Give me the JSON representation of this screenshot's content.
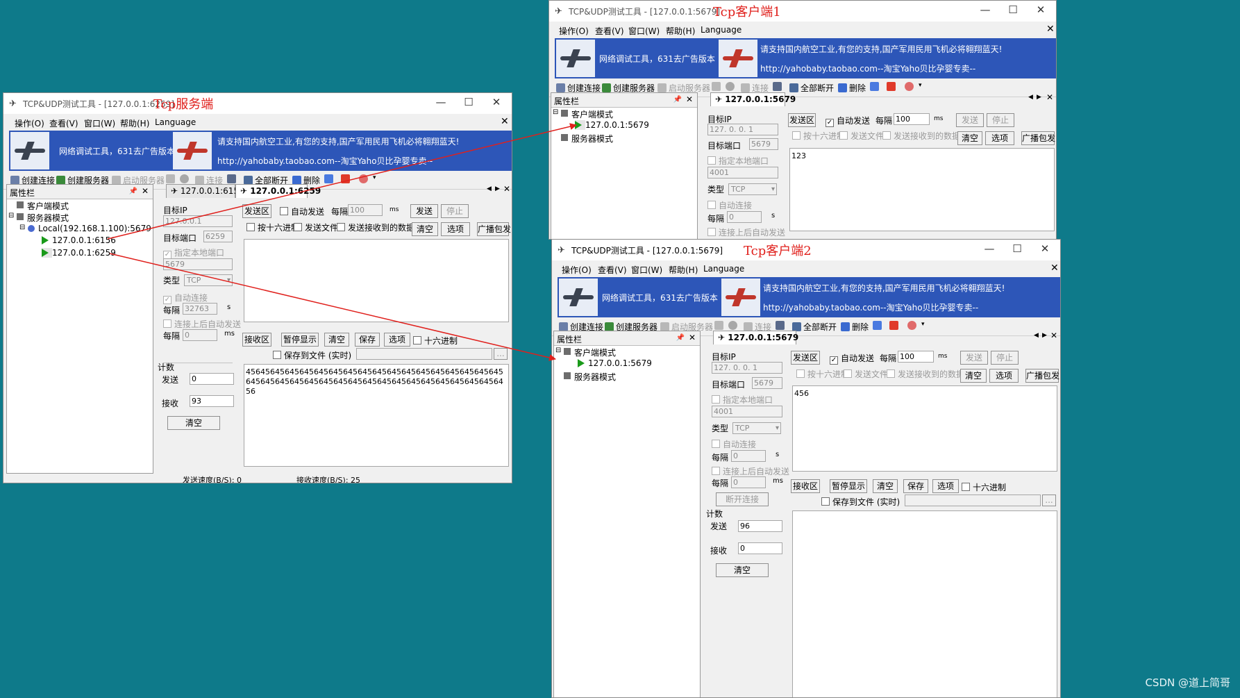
{
  "common": {
    "menu": [
      "操作(O)",
      "查看(V)",
      "窗口(W)",
      "帮助(H)",
      "Language"
    ],
    "banner_ad": "网络调试工具，631去广告版本",
    "banner_slogan": "请支持国内航空工业,有您的支持,国产军用民用飞机必将翱翔蓝天!",
    "banner_url": "http://yahobaby.taobao.com--淘宝Yaho贝比孕婴专卖--",
    "toolbar": {
      "create_conn": "创建连接",
      "create_server": "创建服务器",
      "start_server": "启动服务器",
      "connect": "连接",
      "disconnect_all": "全部断开",
      "delete": "删除"
    },
    "props_title": "属性栏",
    "tree_client": "客户端模式",
    "tree_server": "服务器模式",
    "target_ip_label": "目标IP",
    "target_port_label": "目标端口",
    "local_port_label": "指定本地端口",
    "type_label": "类型",
    "auto_connect_label": "自动连接",
    "every_label": "每隔",
    "auto_send_after_label": "连接上后自动发送",
    "send_area": "发送区",
    "auto_send": "自动发送",
    "ms": "ms",
    "s": "s",
    "send": "发送",
    "stop": "停止",
    "hex_send": "按十六进制",
    "send_file": "发送文件",
    "send_received": "发送接收到的数据",
    "clear": "清空",
    "options": "选项",
    "broadcast": "广播包发",
    "recv_area": "接收区",
    "pause_display": "暂停显示",
    "save": "保存",
    "hex": "十六进制",
    "save_to_file": "保存到文件 (实时)",
    "count": "计数",
    "sent": "发送",
    "received": "接收",
    "disconnect": "断开连接",
    "ellipsis": "..."
  },
  "server": {
    "title": "TCP&UDP测试工具 - [127.0.0.1:6259]",
    "caption": "Tcp服务端",
    "local": "Local(192.168.1.100):5679",
    "client1": "127.0.0.1:6156",
    "client2": "127.0.0.1:6259",
    "tab1": "127.0.0.1:6156",
    "tab2": "127.0.0.1:6259",
    "target_ip": "127.0.0.1",
    "target_port": "6259",
    "local_port": "5679",
    "type": "TCP",
    "every_s": "32763",
    "every_ms": "0",
    "send_interval": "100",
    "sent_count": "0",
    "recv_count": "93",
    "recv_text": "456456456456456456456456456456456456456456456456456456456456456456456456456456456456456456456456456456456456",
    "send_speed": "发送速度(B/S): 0",
    "recv_speed": "接收速度(B/S): 25"
  },
  "client1": {
    "title": "TCP&UDP测试工具 - [127.0.0.1:5679]",
    "caption": "Tcp客户端1",
    "tree_item": "127.0.0.1:5679",
    "tab": "127.0.0.1:5679",
    "target_ip": "127. 0. 0. 1",
    "target_port": "5679",
    "local_port": "4001",
    "type": "TCP",
    "every_s": "0",
    "send_interval": "100",
    "send_text": "123"
  },
  "client2": {
    "title": "TCP&UDP测试工具 - [127.0.0.1:5679]",
    "caption": "Tcp客户端2",
    "tree_item": "127.0.0.1:5679",
    "tab": "127.0.0.1:5679",
    "target_ip": "127. 0. 0. 1",
    "target_port": "5679",
    "local_port": "4001",
    "type": "TCP",
    "every_s": "0",
    "every_ms": "0",
    "send_interval": "100",
    "send_text": "456",
    "sent_count": "96",
    "recv_count": "0"
  },
  "watermark": "CSDN @道上简哥",
  "colors": {
    "desktop": "#0e7a8a",
    "banner": "#2d56b8",
    "caption": "#e0201c",
    "arrow": "#e0201c"
  }
}
